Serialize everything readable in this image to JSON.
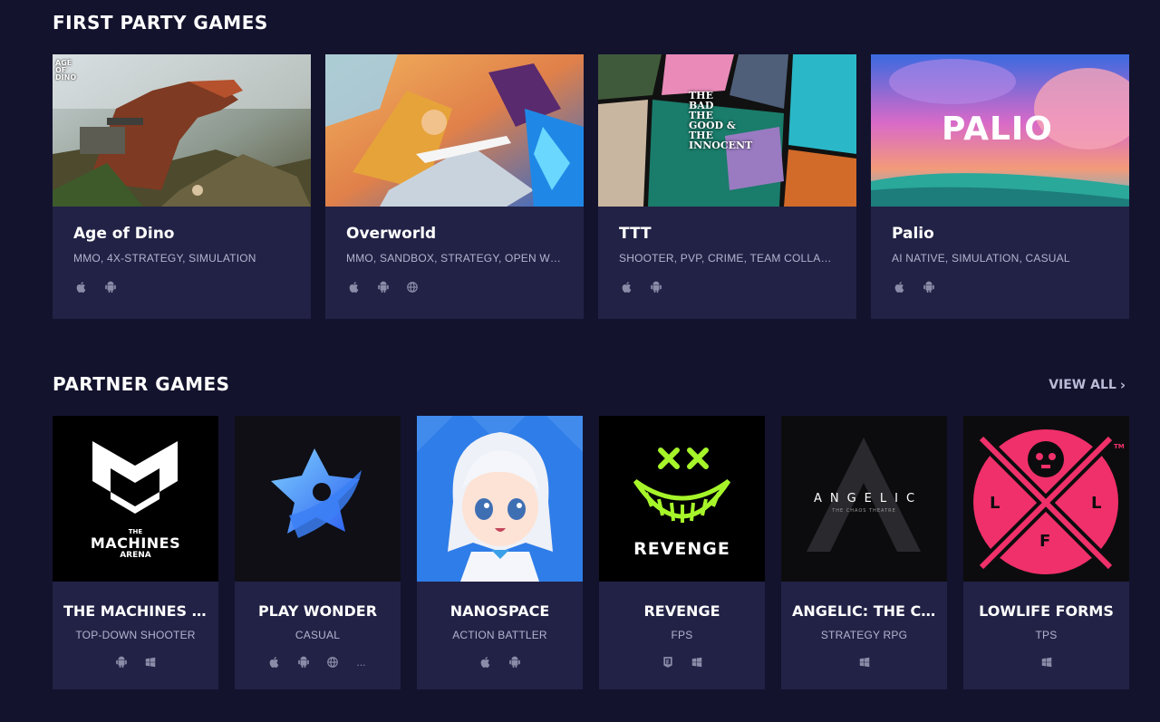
{
  "first_party": {
    "title": "FIRST PARTY GAMES",
    "games": [
      {
        "name": "Age of Dino",
        "tags": "MMO, 4X-STRATEGY, SIMULATION",
        "art_text": "AGE OF DINO",
        "platforms": [
          "apple",
          "android"
        ]
      },
      {
        "name": "Overworld",
        "tags": "MMO, SANDBOX, STRATEGY, OPEN WORLD",
        "platforms": [
          "apple",
          "android",
          "web"
        ]
      },
      {
        "name": "TTT",
        "tags": "SHOOTER, PVP, CRIME, TEAM COLLABORATION",
        "art_text": [
          "THE",
          "BAD",
          "THE",
          "GOOD &",
          "THE",
          "INNOCENT"
        ],
        "platforms": [
          "apple",
          "android"
        ]
      },
      {
        "name": "Palio",
        "tags": "AI NATIVE, SIMULATION, CASUAL",
        "art_text": "PALIO",
        "platforms": [
          "apple",
          "android"
        ]
      }
    ]
  },
  "partner": {
    "title": "PARTNER GAMES",
    "view_all": "VIEW ALL",
    "games": [
      {
        "name": "THE MACHINES ARENA",
        "genre": "TOP-DOWN SHOOTER",
        "logo_text": [
          "THE",
          "MACHINES",
          "ARENA"
        ],
        "platforms": [
          "android",
          "windows"
        ]
      },
      {
        "name": "PLAY WONDER",
        "genre": "CASUAL",
        "platforms": [
          "apple",
          "android",
          "web",
          "more"
        ]
      },
      {
        "name": "NANOSPACE",
        "genre": "ACTION BATTLER",
        "platforms": [
          "apple",
          "android"
        ]
      },
      {
        "name": "REVENGE",
        "genre": "FPS",
        "logo_text": "REVENGE",
        "platforms": [
          "epic",
          "windows"
        ]
      },
      {
        "name": "ANGELIC: THE CHAOS THEATRE",
        "genre": "STRATEGY RPG",
        "logo_text": [
          "ANGELIC",
          "THE CHAOS THEATRE"
        ],
        "platforms": [
          "windows"
        ]
      },
      {
        "name": "LOWLIFE FORMS",
        "genre": "TPS",
        "logo_text": [
          "L",
          "L",
          "F",
          "TM"
        ],
        "platforms": [
          "windows"
        ]
      }
    ]
  },
  "colors": {
    "background": "#13132e",
    "card": "#222246",
    "muted_text": "#b2b4cf",
    "icon": "#8a8ca8",
    "revenge_green": "#a6f52a",
    "llf_pink": "#f0306a",
    "nanospace_blue": "#2f7de8"
  },
  "more_glyph": "..."
}
